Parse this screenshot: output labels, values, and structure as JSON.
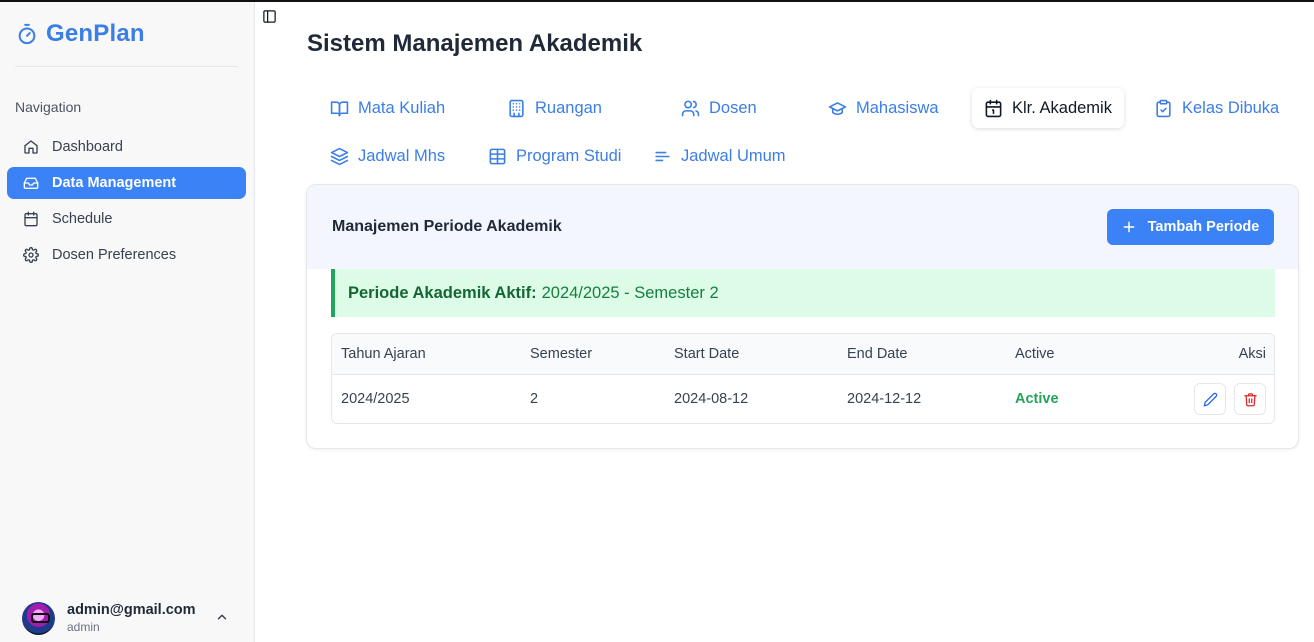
{
  "brand": {
    "name": "GenPlan"
  },
  "sidebar": {
    "group_label": "Navigation",
    "items": [
      {
        "label": "Dashboard",
        "icon": "home-icon"
      },
      {
        "label": "Data Management",
        "icon": "inbox-icon",
        "active": true
      },
      {
        "label": "Schedule",
        "icon": "calendar-icon"
      },
      {
        "label": "Dosen Preferences",
        "icon": "gear-icon"
      }
    ],
    "user": {
      "email": "admin@gmail.com",
      "role": "admin"
    }
  },
  "page": {
    "title": "Sistem Manajemen Akademik"
  },
  "tabs": [
    {
      "label": "Mata Kuliah",
      "icon": "book-icon"
    },
    {
      "label": "Ruangan",
      "icon": "building-icon"
    },
    {
      "label": "Dosen",
      "icon": "users-icon"
    },
    {
      "label": "Mahasiswa",
      "icon": "graduation-cap-icon"
    },
    {
      "label": "Klr. Akademik",
      "icon": "calendar-icon",
      "active": true
    },
    {
      "label": "Kelas Dibuka",
      "icon": "clipboard-check-icon"
    },
    {
      "label": "Jadwal Mhs",
      "icon": "layers-icon"
    },
    {
      "label": "Program Studi",
      "icon": "table-icon"
    },
    {
      "label": "Jadwal Umum",
      "icon": "align-left-icon"
    }
  ],
  "card": {
    "title": "Manajemen Periode Akademik",
    "add_button": "Tambah Periode",
    "alert_label": "Periode Akademik Aktif:",
    "alert_value": "2024/2025 - Semester 2",
    "table": {
      "headers": [
        "Tahun Ajaran",
        "Semester",
        "Start Date",
        "End Date",
        "Active",
        "Aksi"
      ],
      "rows": [
        {
          "tahun": "2024/2025",
          "semester": "2",
          "start": "2024-08-12",
          "end": "2024-12-12",
          "status": "Active"
        }
      ]
    }
  },
  "colors": {
    "accent": "#3b82f6",
    "brand": "#3b7ee6",
    "success": "#22a55b",
    "danger": "#dc2626"
  }
}
